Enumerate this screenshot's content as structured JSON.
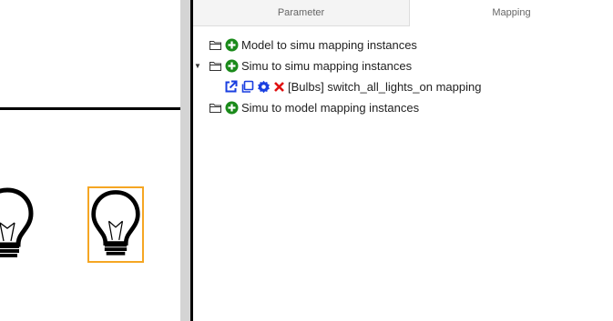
{
  "tabs": [
    {
      "label": "Parameter"
    },
    {
      "label": "Mapping"
    }
  ],
  "tree": {
    "model_to_simu": {
      "label": "Model to simu mapping instances"
    },
    "simu_to_simu": {
      "label": "Simu to simu mapping instances",
      "expanded": true,
      "children": [
        {
          "label": "[Bulbs] switch_all_lights_on mapping"
        }
      ]
    },
    "simu_to_model": {
      "label": "Simu to model mapping instances"
    }
  },
  "icons": {
    "folder": "folder-icon",
    "add": "plus-circle-icon",
    "expand": "caret-down-icon",
    "open": "external-link-icon",
    "duplicate": "copy-icon",
    "settings": "gear-icon",
    "delete": "close-icon"
  },
  "colors": {
    "add_icon": "#1a8a1a",
    "action_icons": "#1a3fe0",
    "delete_icon": "#e01010",
    "selection_border": "#f5a623"
  }
}
